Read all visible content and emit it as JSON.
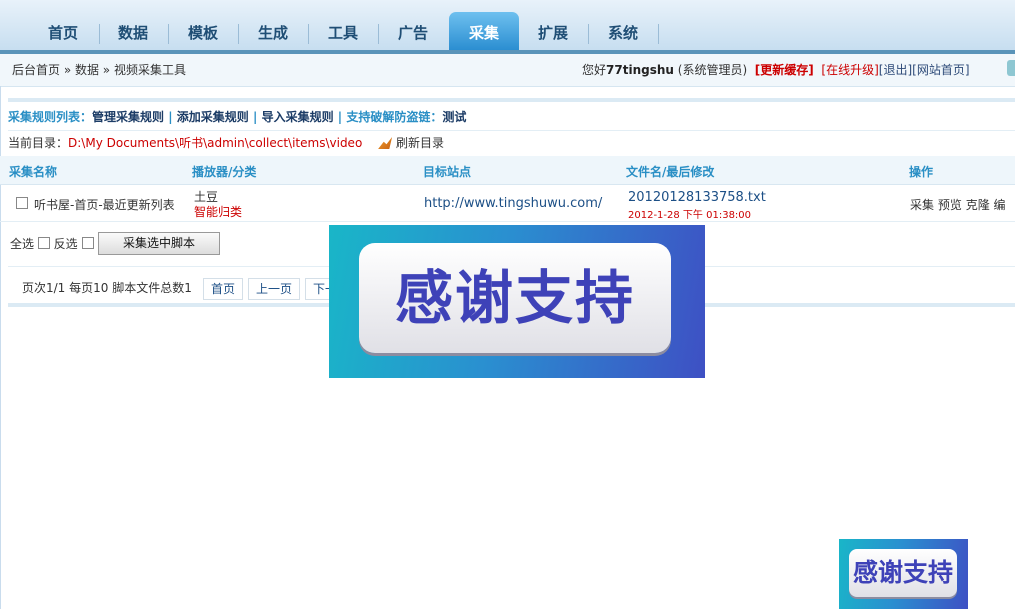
{
  "nav": {
    "tabs": [
      {
        "label": "首页"
      },
      {
        "label": "数据"
      },
      {
        "label": "模板"
      },
      {
        "label": "生成"
      },
      {
        "label": "工具"
      },
      {
        "label": "广告"
      },
      {
        "label": "采集",
        "active": true
      },
      {
        "label": "扩展"
      },
      {
        "label": "系统"
      }
    ]
  },
  "header": {
    "breadcrumb": "后台首页 » 数据 » 视频采集工具",
    "greeting": "您好",
    "username": "77tingshu",
    "role": "(系统管理员)",
    "update_cache": "[更新缓存]",
    "online_upgrade": "[在线升级]",
    "logout": "[退出]",
    "site_home": "[网站首页]"
  },
  "links": {
    "list_label": "采集规则列表：",
    "manage": "管理采集规则",
    "add": "添加采集规则",
    "import": "导入采集规则",
    "hotlink_label": "支持破解防盗链：",
    "test": "测试",
    "separator": "|"
  },
  "dir": {
    "label": "当前目录：",
    "path": "D:\\My Documents\\听书\\admin\\collect\\items\\video",
    "refresh": "刷新目录"
  },
  "table": {
    "headers": {
      "name": "采集名称",
      "player": "播放器/分类",
      "site": "目标站点",
      "file": "文件名/最后修改",
      "ops": "操作"
    },
    "rows": [
      {
        "name": "听书屋-首页-最近更新列表",
        "player": "土豆",
        "category": "智能归类",
        "site": "http://www.tingshuwu.com/",
        "file": "20120128133758.txt",
        "modified": "2012-1-28 下午 01:38:00",
        "ops": [
          "采集",
          "预览",
          "克隆",
          "编"
        ]
      }
    ]
  },
  "select": {
    "all": "全选",
    "invert": "反选",
    "collect_button": "采集选中脚本"
  },
  "pager": {
    "info": "页次1/1 每页10 脚本文件总数1",
    "first": "首页",
    "prev": "上一页",
    "next": "下一"
  },
  "overlay": {
    "thanks": "感谢支持"
  },
  "colors": {
    "accent": "#2a8fc5",
    "nav_active": "#2b8ed1",
    "danger": "#cc0000",
    "overlay_bg": "#2a8fd0"
  }
}
